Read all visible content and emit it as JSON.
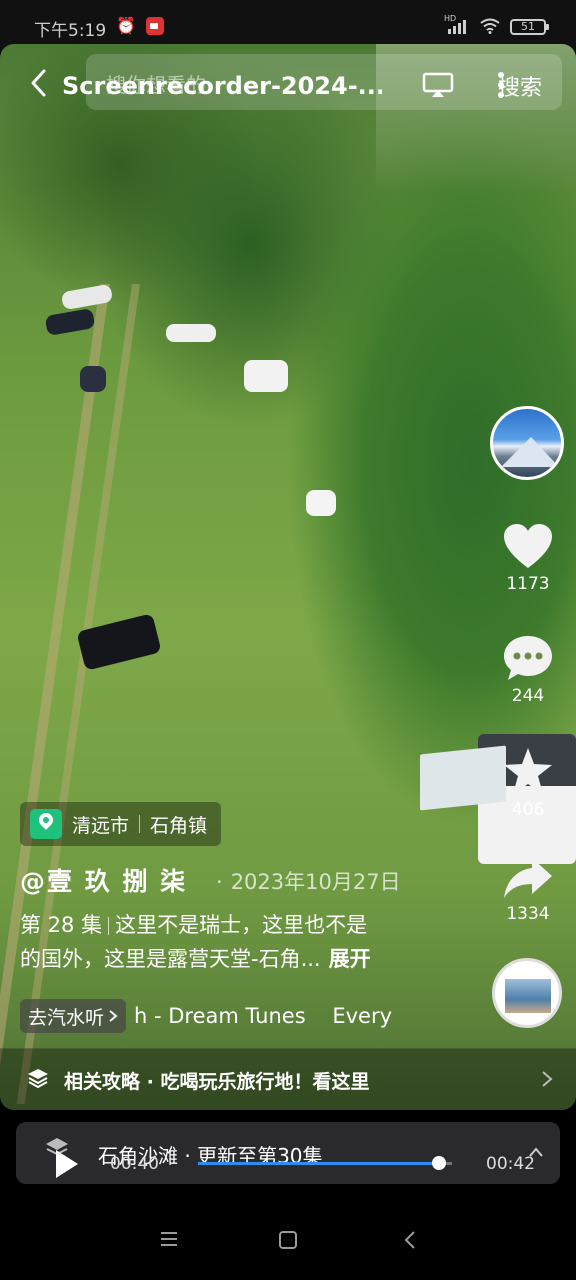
{
  "status_bar": {
    "time": "下午5:19",
    "battery": "51",
    "network": "HD"
  },
  "top_bar": {
    "title": "Screenrecorder-2024-...",
    "search_placeholder": "搜你想看的",
    "search_button": "搜索"
  },
  "rail": {
    "likes": "1173",
    "comments": "244",
    "favorites": "406",
    "shares": "1334"
  },
  "post": {
    "location_city": "清远市",
    "location_town": "石角镇",
    "author": "@壹 玖 捌 柒",
    "date": "2023年10月27日",
    "episode": "第 28 集",
    "description_line1": "这里不是瑞士，这里也不是",
    "description_line2": "的国外，这里是露营天堂-石角...",
    "expand": "展开",
    "music_button": "去汽水听",
    "music_title": "h - Dream Tunes    Every"
  },
  "guide": {
    "text": "相关攻略 · 吃喝玩乐旅行地！看这里"
  },
  "player": {
    "series": "石角沙滩 · 更新至第30集",
    "time_current": "00:40",
    "time_total": "00:42",
    "progress": 0.95
  },
  "colors": {
    "accent": "#2e8ef0",
    "location_pin": "#1fc27d"
  }
}
